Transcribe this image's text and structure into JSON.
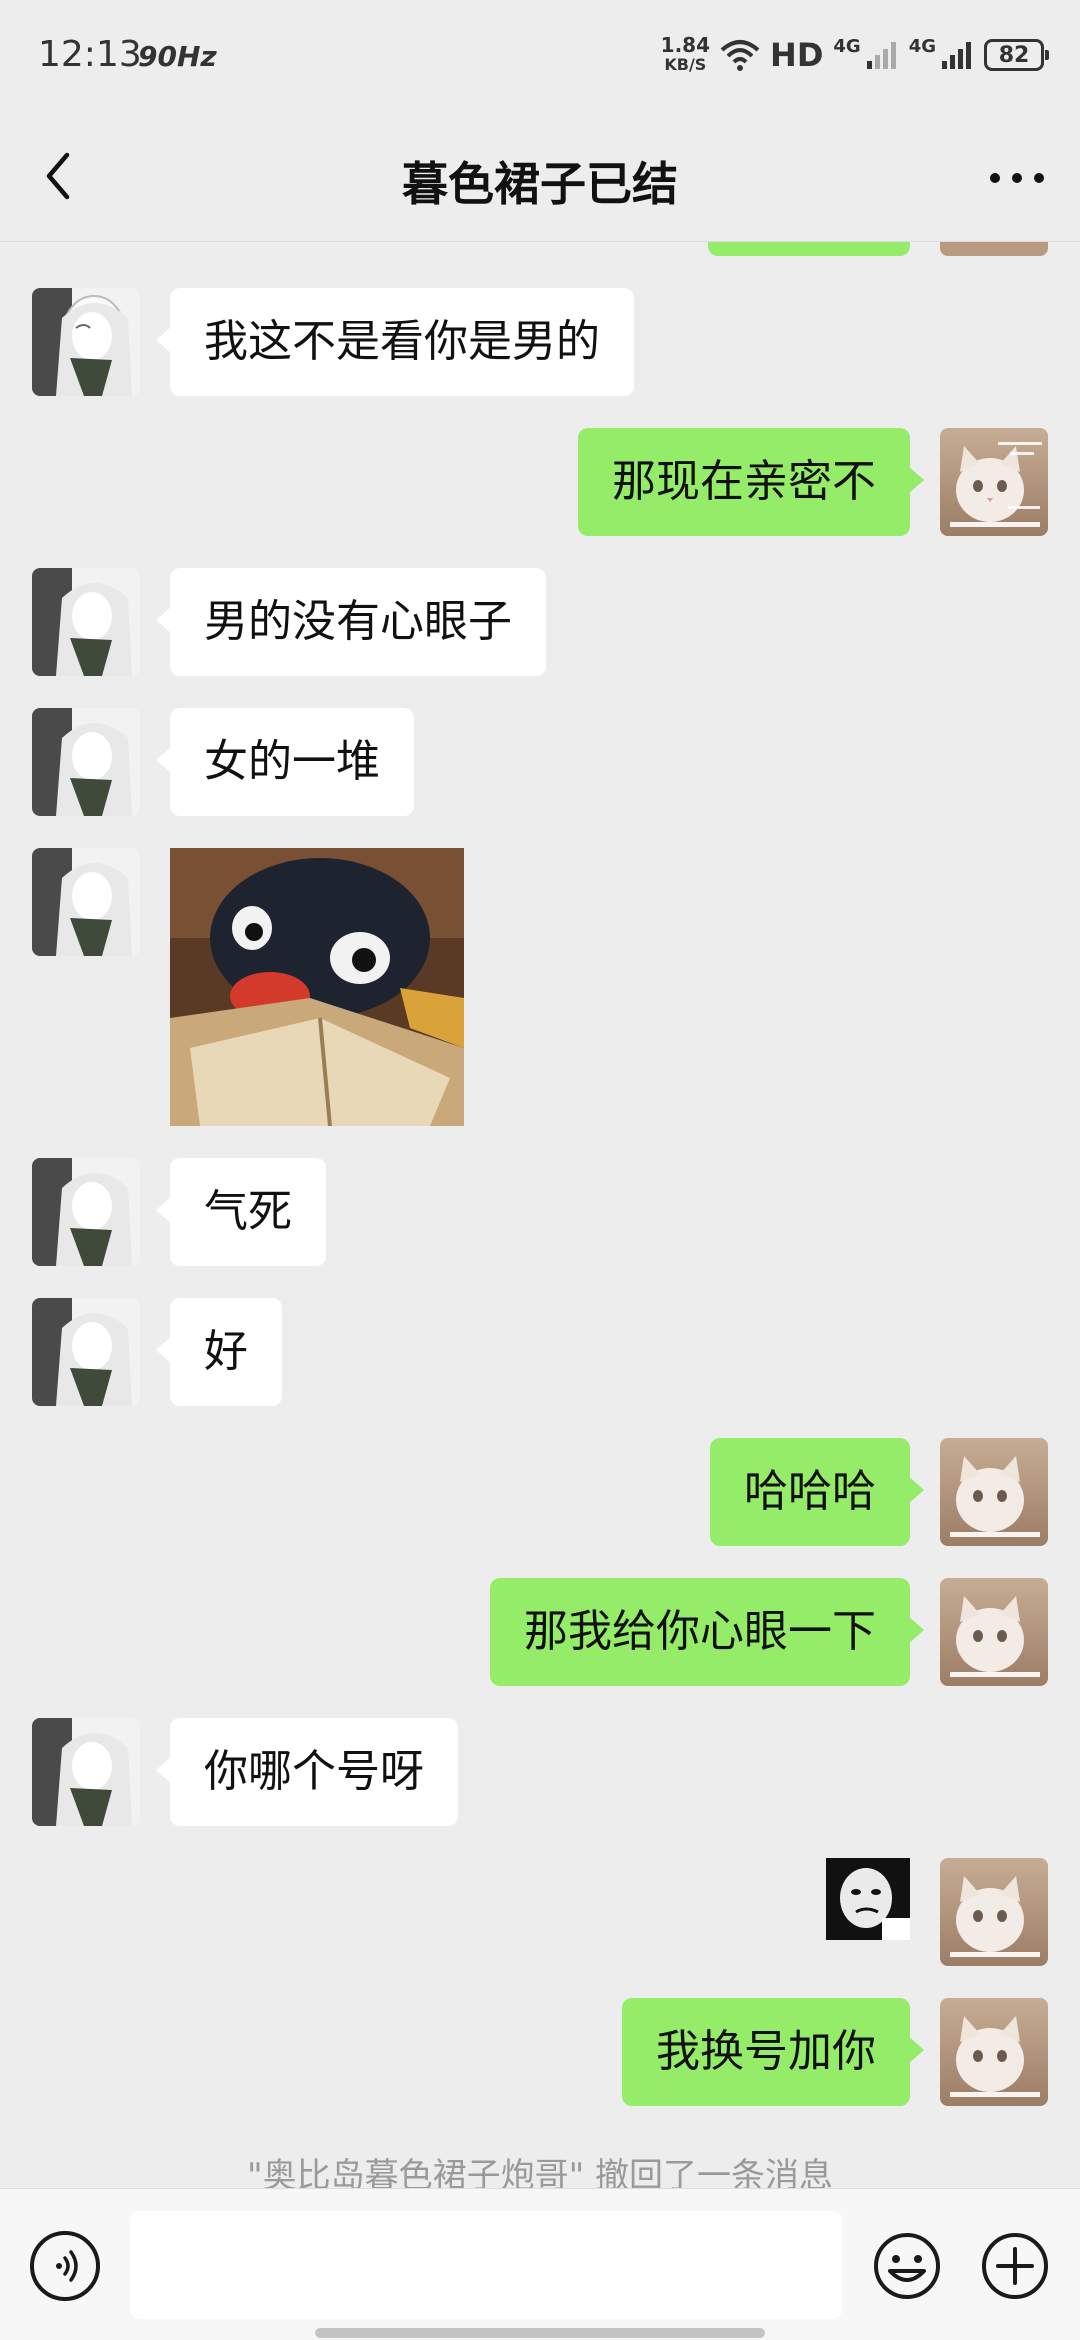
{
  "status_bar": {
    "time": "12:13",
    "refresh_rate": "90Hz",
    "net_speed_value": "1.84",
    "net_speed_unit": "KB/S",
    "hd_label": "HD",
    "network_label_1": "4G",
    "network_label_2": "4G",
    "battery_level": "82"
  },
  "header": {
    "title": "暮色裙子已结",
    "back_icon": "chevron-left-icon",
    "more_icon": "more-dots-icon"
  },
  "messages": [
    {
      "side": "in",
      "type": "text",
      "text": "我这不是看你是男的"
    },
    {
      "side": "out",
      "type": "text",
      "text": "那现在亲密不"
    },
    {
      "side": "in",
      "type": "text",
      "text": "男的没有心眼子"
    },
    {
      "side": "in",
      "type": "text",
      "text": "女的一堆"
    },
    {
      "side": "in",
      "type": "sticker",
      "sticker": "penguin-reading-sticker"
    },
    {
      "side": "in",
      "type": "text",
      "text": "气死"
    },
    {
      "side": "in",
      "type": "text",
      "text": "好"
    },
    {
      "side": "out",
      "type": "text",
      "text": "哈哈哈"
    },
    {
      "side": "out",
      "type": "text",
      "text": "那我给你心眼一下"
    },
    {
      "side": "in",
      "type": "text",
      "text": "你哪个号呀"
    },
    {
      "side": "out",
      "type": "sticker",
      "sticker": "face-sticker"
    },
    {
      "side": "out",
      "type": "text",
      "text": "我换号加你"
    }
  ],
  "system_notice": "\"奥比岛暮色裙子炮哥\" 撤回了一条消息",
  "input_bar": {
    "voice_icon": "voice-icon",
    "input_value": "",
    "emoji_icon": "emoji-icon",
    "plus_icon": "plus-icon"
  },
  "colors": {
    "background": "#ededed",
    "incoming_bubble": "#ffffff",
    "outgoing_bubble": "#95ec69"
  }
}
